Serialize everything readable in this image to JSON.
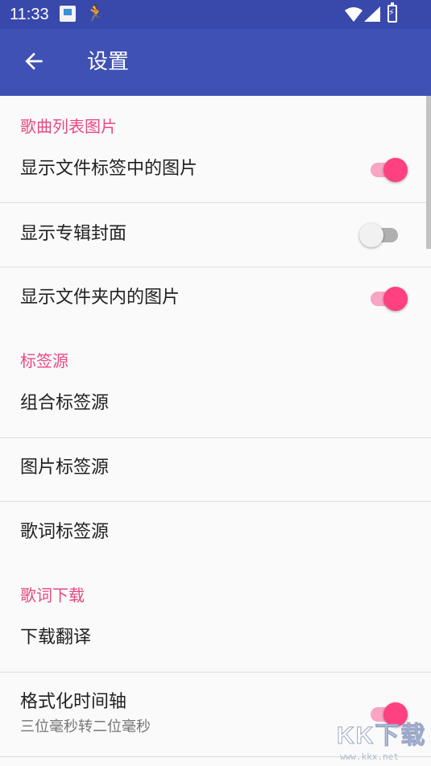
{
  "status_bar": {
    "time": "11:33",
    "icons": [
      "app-notification-icon",
      "running-icon",
      "wifi-icon",
      "cell-signal-icon",
      "battery-charging-icon"
    ]
  },
  "app_bar": {
    "back_icon": "arrow-back-icon",
    "title": "设置"
  },
  "colors": {
    "status_bar": "#3949ab",
    "app_bar": "#3f51b5",
    "accent": "#ff4081",
    "section_header": "#e84a83"
  },
  "sections": [
    {
      "header": "歌曲列表图片",
      "items": [
        {
          "title": "显示文件标签中的图片",
          "switch": true
        },
        {
          "title": "显示专辑封面",
          "switch": false
        },
        {
          "title": "显示文件夹内的图片",
          "switch": true
        }
      ]
    },
    {
      "header": "标签源",
      "items": [
        {
          "title": "组合标签源"
        },
        {
          "title": "图片标签源"
        },
        {
          "title": "歌词标签源"
        }
      ]
    },
    {
      "header": "歌词下载",
      "items": [
        {
          "title": "下载翻译"
        },
        {
          "title": "格式化时间轴",
          "subtitle": "三位毫秒转二位毫秒",
          "switch": true
        }
      ]
    }
  ],
  "watermark": {
    "logo": "KK下载",
    "url": "www.kkx.net"
  }
}
